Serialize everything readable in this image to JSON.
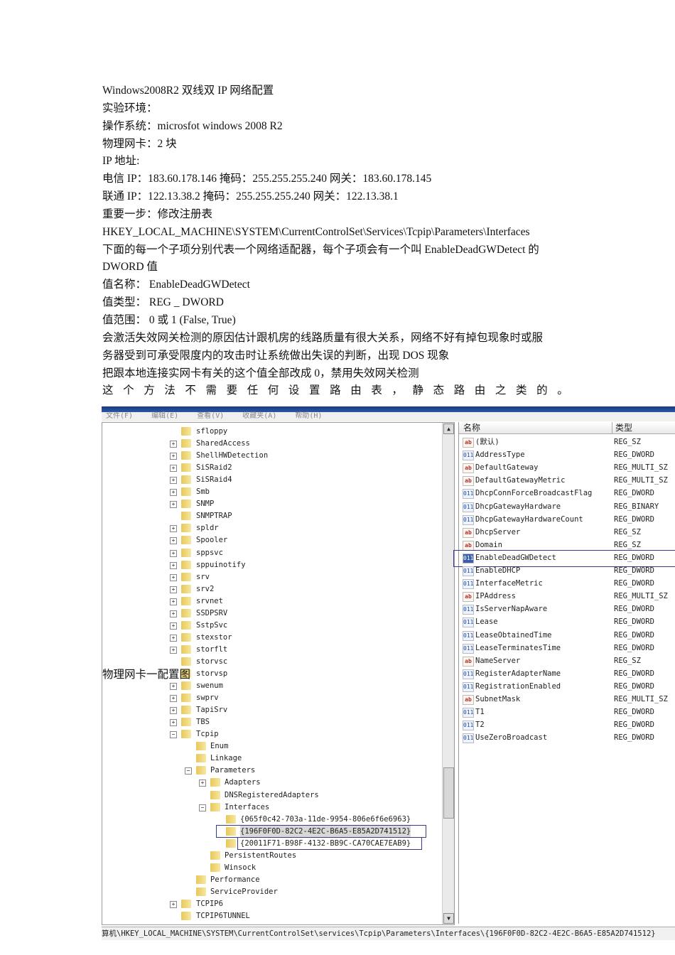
{
  "document": {
    "lines": [
      "Windows2008R2 双线双 IP 网络配置",
      "实验环境：",
      "操作系统：microsfot windows 2008 R2",
      "物理网卡：2 块",
      "IP 地址:",
      "电信 IP：183.60.178.146 掩码：255.255.255.240 网关：183.60.178.145",
      "联通 IP：122.13.38.2 掩码：255.255.255.240 网关：122.13.38.1",
      "重要一步：修改注册表",
      "HKEY_LOCAL_MACHINE\\SYSTEM\\CurrentControlSet\\Services\\Tcpip\\Parameters\\Interfaces",
      "下面的每一个子项分别代表一个网络适配器，每个子项会有一个叫 EnableDeadGWDetect 的",
      "DWORD 值",
      "值名称：   EnableDeadGWDetect",
      "值类型：   REG _ DWORD",
      "值范围：   0  或  1 (False, True)",
      "会激活失效网关检测的原因估计跟机房的线路质量有很大关系，网络不好有掉包现象时或服",
      "务器受到可承受限度内的攻击时让系统做出失误的判断，出现 DOS 现象",
      "把跟本地连接实网卡有关的这个值全部改成 0，禁用失效网关检测"
    ],
    "last_line": "这个方法不需要任何设置路由表，静态路由之类的。",
    "caption": "物理网卡一配置图"
  },
  "regedit": {
    "menu": [
      "文件(F)",
      "编辑(E)",
      "查看(V)",
      "收藏夹(A)",
      "帮助(H)"
    ],
    "columns": {
      "name": "名称",
      "type": "类型"
    },
    "tree": [
      {
        "label": "sfloppy",
        "level": 0,
        "expander": ""
      },
      {
        "label": "SharedAccess",
        "level": 0,
        "expander": "+"
      },
      {
        "label": "ShellHWDetection",
        "level": 0,
        "expander": "+"
      },
      {
        "label": "SiSRaid2",
        "level": 0,
        "expander": "+"
      },
      {
        "label": "SiSRaid4",
        "level": 0,
        "expander": "+"
      },
      {
        "label": "Smb",
        "level": 0,
        "expander": "+"
      },
      {
        "label": "SNMP",
        "level": 0,
        "expander": "+"
      },
      {
        "label": "SNMPTRAP",
        "level": 0,
        "expander": ""
      },
      {
        "label": "spldr",
        "level": 0,
        "expander": "+"
      },
      {
        "label": "Spooler",
        "level": 0,
        "expander": "+"
      },
      {
        "label": "sppsvc",
        "level": 0,
        "expander": "+"
      },
      {
        "label": "sppuinotify",
        "level": 0,
        "expander": "+"
      },
      {
        "label": "srv",
        "level": 0,
        "expander": "+"
      },
      {
        "label": "srv2",
        "level": 0,
        "expander": "+"
      },
      {
        "label": "srvnet",
        "level": 0,
        "expander": "+"
      },
      {
        "label": "SSDPSRV",
        "level": 0,
        "expander": "+"
      },
      {
        "label": "SstpSvc",
        "level": 0,
        "expander": "+"
      },
      {
        "label": "stexstor",
        "level": 0,
        "expander": "+"
      },
      {
        "label": "storflt",
        "level": 0,
        "expander": "+"
      },
      {
        "label": "storvsc",
        "level": 0,
        "expander": ""
      },
      {
        "label": "storvsp",
        "level": 0,
        "expander": ""
      },
      {
        "label": "swenum",
        "level": 0,
        "expander": "+"
      },
      {
        "label": "swprv",
        "level": 0,
        "expander": "+"
      },
      {
        "label": "TapiSrv",
        "level": 0,
        "expander": "+"
      },
      {
        "label": "TBS",
        "level": 0,
        "expander": "+"
      },
      {
        "label": "Tcpip",
        "level": 0,
        "expander": "−"
      },
      {
        "label": "Enum",
        "level": 1,
        "expander": ""
      },
      {
        "label": "Linkage",
        "level": 1,
        "expander": ""
      },
      {
        "label": "Parameters",
        "level": 1,
        "expander": "−"
      },
      {
        "label": "Adapters",
        "level": 2,
        "expander": "+"
      },
      {
        "label": "DNSRegisteredAdapters",
        "level": 2,
        "expander": ""
      },
      {
        "label": "Interfaces",
        "level": 2,
        "expander": "−"
      },
      {
        "label": "{065f0c42-703a-11de-9954-806e6f6e6963}",
        "level": 3,
        "expander": ""
      },
      {
        "label": "{196F0F0D-82C2-4E2C-B6A5-E85A2D741512}",
        "level": 3,
        "expander": "",
        "selected": true
      },
      {
        "label": "{20011F71-B98F-4132-BB9C-CA70CAE7EAB9}",
        "level": 3,
        "expander": "",
        "boxed": true
      },
      {
        "label": "PersistentRoutes",
        "level": 2,
        "expander": ""
      },
      {
        "label": "Winsock",
        "level": 2,
        "expander": ""
      },
      {
        "label": "Performance",
        "level": 1,
        "expander": ""
      },
      {
        "label": "ServiceProvider",
        "level": 1,
        "expander": ""
      },
      {
        "label": "TCPIP6",
        "level": 0,
        "expander": "+"
      },
      {
        "label": "TCPIP6TUNNEL",
        "level": 0,
        "expander": ""
      }
    ],
    "values": [
      {
        "icon": "ab",
        "name": "(默认)",
        "type": "REG_SZ"
      },
      {
        "icon": "bin",
        "name": "AddressType",
        "type": "REG_DWORD"
      },
      {
        "icon": "ab",
        "name": "DefaultGateway",
        "type": "REG_MULTI_SZ"
      },
      {
        "icon": "ab",
        "name": "DefaultGatewayMetric",
        "type": "REG_MULTI_SZ"
      },
      {
        "icon": "bin",
        "name": "DhcpConnForceBroadcastFlag",
        "type": "REG_DWORD"
      },
      {
        "icon": "bin",
        "name": "DhcpGatewayHardware",
        "type": "REG_BINARY"
      },
      {
        "icon": "bin",
        "name": "DhcpGatewayHardwareCount",
        "type": "REG_DWORD"
      },
      {
        "icon": "ab",
        "name": "DhcpServer",
        "type": "REG_SZ"
      },
      {
        "icon": "ab",
        "name": "Domain",
        "type": "REG_SZ"
      },
      {
        "icon": "bin",
        "name": "EnableDeadGWDetect",
        "type": "REG_DWORD",
        "selected": true
      },
      {
        "icon": "bin",
        "name": "EnableDHCP",
        "type": "REG_DWORD"
      },
      {
        "icon": "bin",
        "name": "InterfaceMetric",
        "type": "REG_DWORD"
      },
      {
        "icon": "ab",
        "name": "IPAddress",
        "type": "REG_MULTI_SZ"
      },
      {
        "icon": "bin",
        "name": "IsServerNapAware",
        "type": "REG_DWORD"
      },
      {
        "icon": "bin",
        "name": "Lease",
        "type": "REG_DWORD"
      },
      {
        "icon": "bin",
        "name": "LeaseObtainedTime",
        "type": "REG_DWORD"
      },
      {
        "icon": "bin",
        "name": "LeaseTerminatesTime",
        "type": "REG_DWORD"
      },
      {
        "icon": "ab",
        "name": "NameServer",
        "type": "REG_SZ"
      },
      {
        "icon": "bin",
        "name": "RegisterAdapterName",
        "type": "REG_DWORD"
      },
      {
        "icon": "bin",
        "name": "RegistrationEnabled",
        "type": "REG_DWORD"
      },
      {
        "icon": "ab",
        "name": "SubnetMask",
        "type": "REG_MULTI_SZ"
      },
      {
        "icon": "bin",
        "name": "T1",
        "type": "REG_DWORD"
      },
      {
        "icon": "bin",
        "name": "T2",
        "type": "REG_DWORD"
      },
      {
        "icon": "bin",
        "name": "UseZeroBroadcast",
        "type": "REG_DWORD"
      }
    ],
    "status_path": "算机\\HKEY_LOCAL_MACHINE\\SYSTEM\\CurrentControlSet\\services\\Tcpip\\Parameters\\Interfaces\\{196F0F0D-82C2-4E2C-B6A5-E85A2D741512}"
  }
}
